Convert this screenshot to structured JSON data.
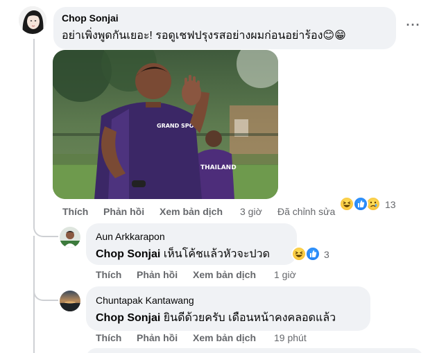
{
  "comments": [
    {
      "author": "Chop Sonjai",
      "text": "อย่าเพิ่งพูดกันเยอะ! รอดูเชฟปรุงรสอย่างผมก่อนอย่าร้อง",
      "emoji": "😊😁",
      "actions": {
        "like": "Thích",
        "reply": "Phản hồi",
        "translate": "Xem bản dịch"
      },
      "time": "3 giờ",
      "edited": "Đã chỉnh sửa",
      "reaction_icons": [
        "haha",
        "like",
        "sad"
      ],
      "reaction_count": "13",
      "photo": {
        "jersey_text": "GRAND SPORT",
        "player_back_text": "THAILAND"
      }
    },
    {
      "author": "Aun Arkkarapon",
      "mention": "Chop Sonjai",
      "text": "เห็นโค้ชแล้วหัวจะปวด",
      "actions": {
        "like": "Thích",
        "reply": "Phản hồi",
        "translate": "Xem bản dịch"
      },
      "time": "1 giờ",
      "reaction_icons": [
        "haha",
        "like"
      ],
      "reaction_count": "3"
    },
    {
      "author": "Chuntapak Kantawang",
      "mention": "Chop Sonjai",
      "text": "ยินดีด้วยครับ เดือนหน้าคงคลอดแล้ว",
      "actions": {
        "like": "Thích",
        "reply": "Phản hồi",
        "translate": "Xem bản dịch"
      },
      "time": "19 phút"
    }
  ],
  "more_options_label": "···",
  "colors": {
    "bubble": "#f0f2f5",
    "meta": "#65676b",
    "thread": "#ced0d4"
  }
}
